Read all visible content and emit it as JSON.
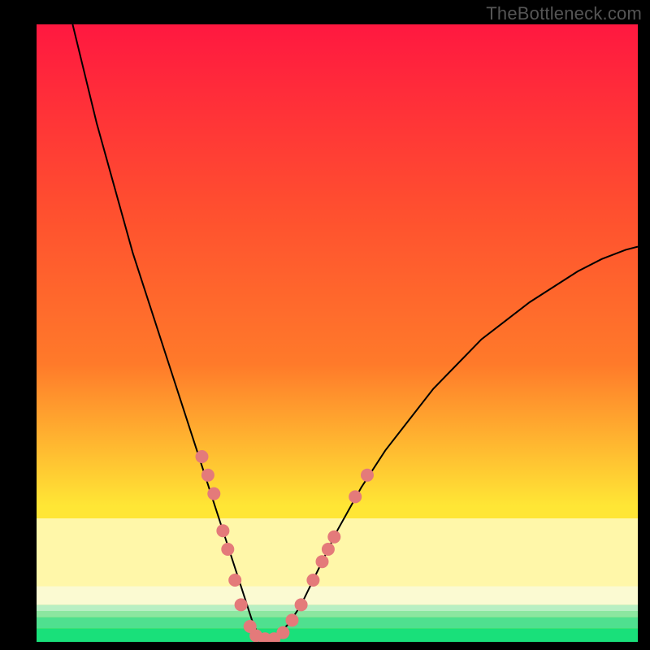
{
  "watermark": "TheBottleneck.com",
  "colors": {
    "frame_bg": "#000000",
    "watermark_color": "#555555",
    "gradient_top": "#ff1840",
    "gradient_mid_upper": "#ff7a2a",
    "gradient_mid": "#ffe635",
    "gradient_cream_top": "#fff8b0",
    "gradient_cream_bottom": "#fbfad2",
    "gradient_green_top": "#8ce6a0",
    "gradient_green_bottom": "#19e07a",
    "curve_stroke": "#000000",
    "marker_fill": "#e47a7a",
    "marker_stroke": "#c85a5a"
  },
  "chart_data": {
    "type": "line",
    "title": "",
    "xlabel": "",
    "ylabel": "",
    "xlim": [
      0,
      100
    ],
    "ylim": [
      0,
      100
    ],
    "series": [
      {
        "name": "bottleneck-curve",
        "x": [
          6,
          8,
          10,
          12,
          14,
          16,
          18,
          20,
          22,
          24,
          26,
          28,
          30,
          32,
          34,
          35,
          36,
          37,
          38,
          39,
          40,
          42,
          44,
          46,
          48,
          50,
          54,
          58,
          62,
          66,
          70,
          74,
          78,
          82,
          86,
          90,
          94,
          98,
          100
        ],
        "y": [
          100,
          92,
          84,
          77,
          70,
          63,
          57,
          51,
          45,
          39,
          33,
          27,
          21,
          15,
          9,
          6,
          3,
          1,
          0.5,
          0.5,
          1,
          3,
          6,
          10,
          14,
          18,
          25,
          31,
          36,
          41,
          45,
          49,
          52,
          55,
          57.5,
          60,
          62,
          63.5,
          64
        ]
      }
    ],
    "markers": {
      "name": "highlighted-points",
      "points": [
        {
          "x": 27.5,
          "y": 30
        },
        {
          "x": 28.5,
          "y": 27
        },
        {
          "x": 29.5,
          "y": 24
        },
        {
          "x": 31,
          "y": 18
        },
        {
          "x": 31.8,
          "y": 15
        },
        {
          "x": 33,
          "y": 10
        },
        {
          "x": 34,
          "y": 6
        },
        {
          "x": 35.5,
          "y": 2.5
        },
        {
          "x": 36.5,
          "y": 1
        },
        {
          "x": 38,
          "y": 0.5
        },
        {
          "x": 39.5,
          "y": 0.5
        },
        {
          "x": 41,
          "y": 1.5
        },
        {
          "x": 42.5,
          "y": 3.5
        },
        {
          "x": 44,
          "y": 6
        },
        {
          "x": 46,
          "y": 10
        },
        {
          "x": 47.5,
          "y": 13
        },
        {
          "x": 48.5,
          "y": 15
        },
        {
          "x": 49.5,
          "y": 17
        },
        {
          "x": 53,
          "y": 23.5
        },
        {
          "x": 55,
          "y": 27
        }
      ]
    },
    "gradient_bands": [
      {
        "from_y": 100,
        "to_y": 25,
        "type": "smooth",
        "top_color": "gradient_top",
        "bottom_color": "gradient_mid"
      },
      {
        "from_y": 25,
        "to_y": 18,
        "type": "smooth",
        "top_color": "gradient_mid",
        "bottom_color": "gradient_cream_top"
      },
      {
        "from_y": 18,
        "to_y": 7,
        "type": "flat",
        "color": "gradient_cream_top"
      },
      {
        "from_y": 7,
        "to_y": 4,
        "type": "smooth",
        "top_color": "gradient_cream_bottom",
        "bottom_color": "gradient_green_top"
      },
      {
        "from_y": 4,
        "to_y": 0,
        "type": "smooth",
        "top_color": "gradient_green_top",
        "bottom_color": "gradient_green_bottom"
      }
    ]
  }
}
